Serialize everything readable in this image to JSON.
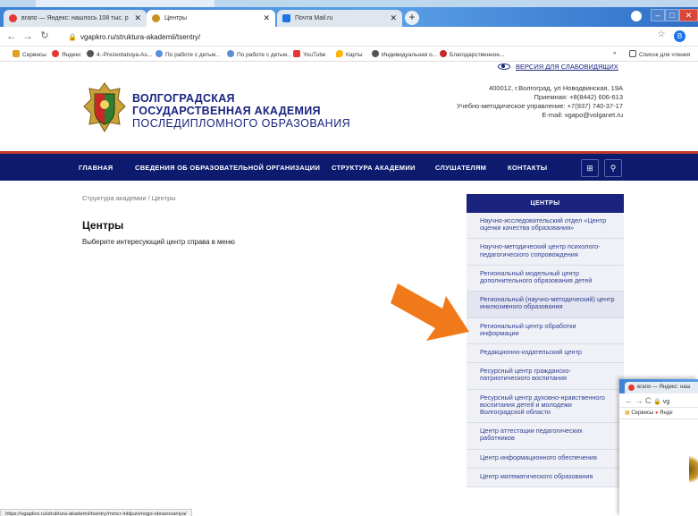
{
  "browser": {
    "tabs": [
      {
        "title": "вгапо — Яндекс: нашлось 108 тыс. р",
        "active": false
      },
      {
        "title": "Центры",
        "active": true
      },
      {
        "title": "Почта Mail.ru",
        "active": false
      }
    ],
    "new_tab_label": "+",
    "address": "vgapkro.ru/struktura-akademii/tsentry/",
    "profile_initial": "B",
    "bookmarks": [
      "Сервисы",
      "Яндекс",
      "4.-Prezentatsiya-As...",
      "По работе с детьм...",
      "По работе с детьм...",
      "YouTube",
      "Карты",
      "Индивидуальная о...",
      "Благодарственное...",
      "»",
      "Список для чтения"
    ],
    "status_url": "https://vgapkro.ru/struktura-akademii/tsentry/rnmcr-inkljuzivnogo-obrazovaniya/"
  },
  "header": {
    "low_vision_link": "ВЕРСИЯ ДЛЯ СЛАБОВИДЯЩИХ",
    "brand_line1": "ВОЛГОГРАДСКАЯ",
    "brand_line2": "ГОСУДАРСТВЕННАЯ АКАДЕМИЯ",
    "brand_line3": "ПОСЛЕДИПЛОМНОГО ОБРАЗОВАНИЯ",
    "address": "400012, г.Волгоград, ул Новодвинская, 19А",
    "reception": "Приемная: +8(8442) 606-613",
    "method_dept": "Учебно-методическое управление: +7(937) 740-37-17",
    "email": "E-mail: vgapo@volganet.ru"
  },
  "nav": {
    "items": [
      "ГЛАВНАЯ",
      "СВЕДЕНИЯ ОБ ОБРАЗОВАТЕЛЬНОЙ ОРГАНИЗАЦИИ",
      "СТРУКТУРА АКАДЕМИИ",
      "СЛУШАТЕЛЯМ",
      "КОНТАКТЫ"
    ]
  },
  "main": {
    "breadcrumb": "Структура академии / Центры",
    "title": "Центры",
    "subtitle": "Выберите интересующий центр справа в меню"
  },
  "sidebar": {
    "header": "ЦЕНТРЫ",
    "items": [
      "Научно-исследовательский отдел «Центр оценки качества образования»",
      "Научно-методический центр психолого-педагогического сопровождения",
      "Региональный модельный центр дополнительного образования детей",
      "Региональный (научно-методический) центр инклюзивного образования",
      "Региональный центр обработки информации",
      "Редакционно-издательский центр",
      "Ресурсный центр гражданско-патриотического воспитания",
      "Ресурсный центр духовно-нравственного воспитания детей и молодежи Волгоградской области",
      "Центр аттестации педагогических работников",
      "Центр информационного обеспечения",
      "Центр математического образования"
    ]
  },
  "second_window": {
    "tab_title": "вгапо — Яндекс: наш",
    "address_fragment": "vg",
    "bookmark_1": "Сервисы",
    "bookmark_2": "Янде"
  },
  "colors": {
    "brand_navy": "#1a237e",
    "nav_bg": "#0d1b6e",
    "nav_accent": "#c0392b",
    "arrow": "#f07a1a"
  }
}
